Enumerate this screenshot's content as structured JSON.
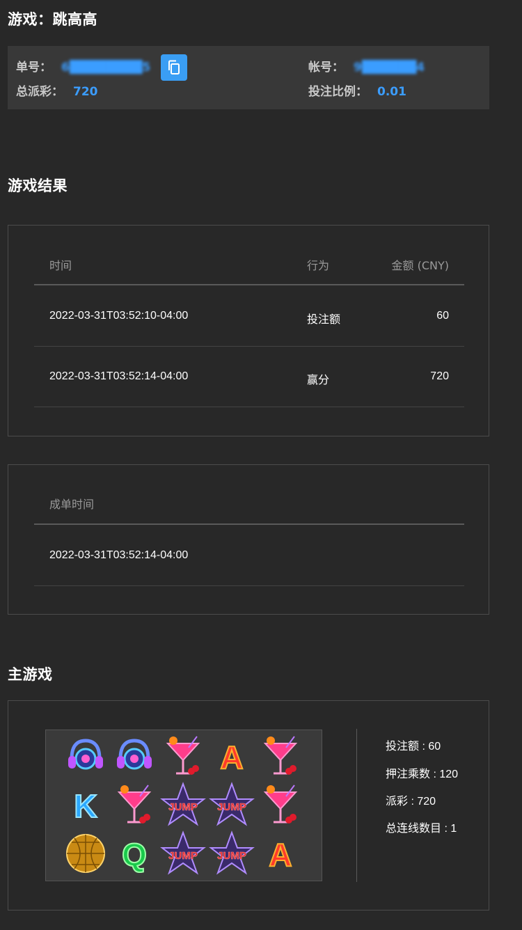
{
  "header": {
    "game_label": "游戏：",
    "game_name": "跳高高"
  },
  "info": {
    "order_label": "单号：",
    "order_value": "6████████5",
    "account_label": "帐号：",
    "account_value": "9██████4",
    "payout_label": "总派彩：",
    "payout_value": "720",
    "ratio_label": "投注比例：",
    "ratio_value": "0.01"
  },
  "result": {
    "title": "游戏结果",
    "columns": [
      "时间",
      "行为",
      "金额 (CNY)"
    ],
    "rows": [
      {
        "time": "2022-03-31T03:52:10-04:00",
        "action": "投注额",
        "amount": "60"
      },
      {
        "time": "2022-03-31T03:52:14-04:00",
        "action": "赢分",
        "amount": "720"
      }
    ]
  },
  "settle": {
    "header": "成单时间",
    "time": "2022-03-31T03:52:14-04:00"
  },
  "main": {
    "title": "主游戏",
    "grid": [
      [
        "headphones-icon",
        "headphones-icon",
        "cocktail-icon",
        "letter-a-icon",
        "cocktail-icon"
      ],
      [
        "letter-k-icon",
        "cocktail-icon",
        "jump-star-icon",
        "jump-star-icon",
        "cocktail-icon"
      ],
      [
        "disco-ball-icon",
        "letter-q-icon",
        "jump-star-icon",
        "jump-star-icon",
        "letter-a-icon"
      ]
    ],
    "stats": {
      "bet": "投注额 : 60",
      "multiplier": "押注乘数 : 120",
      "payout": "派彩 : 720",
      "lines": "总连线数目 : 1"
    }
  },
  "colors": {
    "accent": "#3b9dff",
    "background": "#282828",
    "panel": "#383838",
    "border": "#4c4c4c"
  }
}
